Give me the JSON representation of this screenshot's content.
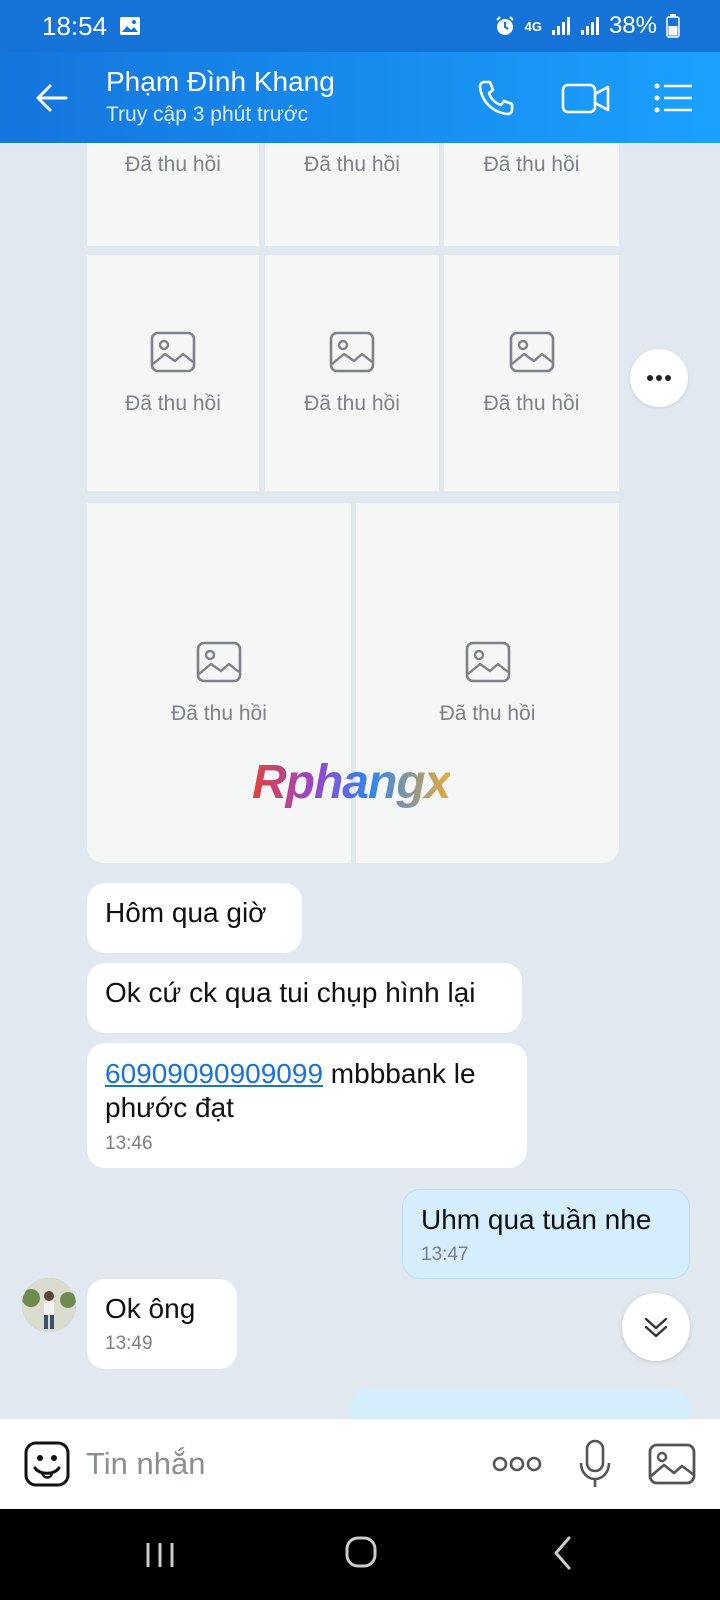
{
  "status_bar": {
    "time": "18:54",
    "network": "4G",
    "battery": "38%"
  },
  "header": {
    "contact_name": "Phạm Đình Khang",
    "contact_status": "Truy cập 3 phút trước"
  },
  "recalled_images": {
    "label": "Đã thu hồi",
    "count": 8
  },
  "watermark": "Rphangx",
  "messages": [
    {
      "side": "received",
      "text": "Hôm qua giờ"
    },
    {
      "side": "received",
      "text": "Ok cứ ck qua tui chụp hình lại"
    },
    {
      "side": "received",
      "link": "60909090909099",
      "text": " mbbbank le phước đạt",
      "time": "13:46"
    },
    {
      "side": "sent",
      "text": "Uhm qua tuần nhe",
      "time": "13:47"
    },
    {
      "side": "received",
      "text": "Ok ông",
      "time": "13:49"
    }
  ],
  "composer": {
    "placeholder": "Tin nhắn"
  },
  "icons": {
    "back": "back-arrow-icon",
    "call": "phone-icon",
    "video": "video-camera-icon",
    "menu": "list-menu-icon",
    "emoji": "sticker-icon",
    "more": "more-dots-icon",
    "mic": "microphone-icon",
    "image": "image-icon",
    "scroll_down": "double-chevron-down-icon"
  },
  "colors": {
    "header_start": "#1475dd",
    "header_end": "#1aa1ff",
    "chat_background": "#e2e8ef",
    "sent_bubble": "#d5eefe",
    "link": "#1a73d8"
  }
}
